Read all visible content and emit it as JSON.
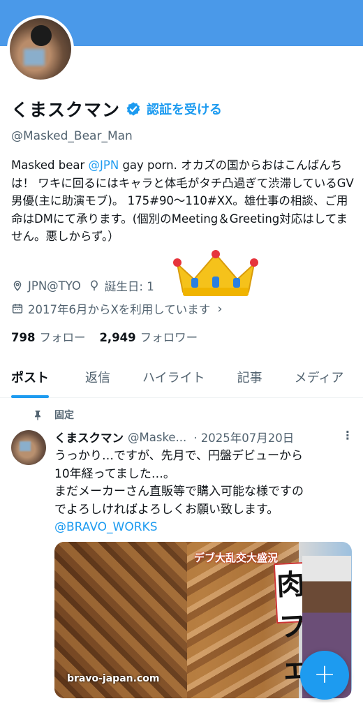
{
  "profile": {
    "display_name": "くまスクマン",
    "verify_link": "認証を受ける",
    "handle": "@Masked_Bear_Man",
    "bio": {
      "pre": "Masked bear ",
      "mention": "@JPN",
      "post": " gay porn. オカズの国からおはこんばんちは！ ワキに回るにはキャラと体毛がタチ凸過ぎて渋滞しているGV男優(主に助演モブ)。 175#90〜110#XX。雄仕事の相談、ご用命はDMにて承ります。(個別のMeeting＆Greeting対応はしてません。悪しからず。）"
    },
    "location": "JPN@TYO",
    "birthday_prefix": "誕生日: 1",
    "birthday_suffix": "日",
    "joined": "2017年6月からXを利用しています",
    "following_count": "798",
    "following_label": "フォロー",
    "followers_count": "2,949",
    "followers_label": "フォロワー"
  },
  "tabs": [
    {
      "label": "ポスト",
      "active": true
    },
    {
      "label": "返信",
      "active": false
    },
    {
      "label": "ハイライト",
      "active": false
    },
    {
      "label": "記事",
      "active": false
    },
    {
      "label": "メディア",
      "active": false
    }
  ],
  "post": {
    "pinned_label": "固定",
    "author_name": "くまスクマン",
    "author_handle": "@Maske...",
    "date": "· 2025年07月20日",
    "text_lines": [
      "うっかり…ですが、先月で、円盤デビューから",
      "10年経ってました…。",
      "まだメーカーさん直販等で購入可能な様ですの",
      "でよろしければよろしくお願い致します。"
    ],
    "mention": "@BRAVO_WORKS",
    "media": {
      "watermark": "bravo-japan.com",
      "cover_text": "肉フェス",
      "title_text": "デブ大乱交大盛況"
    }
  },
  "colors": {
    "banner": "#4a99e9",
    "accent": "#1d9bf0",
    "secondary_text": "#536471"
  },
  "icons": {
    "verified": "verified-badge-icon",
    "location": "location-pin-icon",
    "birthday": "balloon-icon",
    "calendar": "calendar-icon",
    "pin": "pin-icon",
    "fab": "plus-icon",
    "crown": "crown-emoji"
  }
}
